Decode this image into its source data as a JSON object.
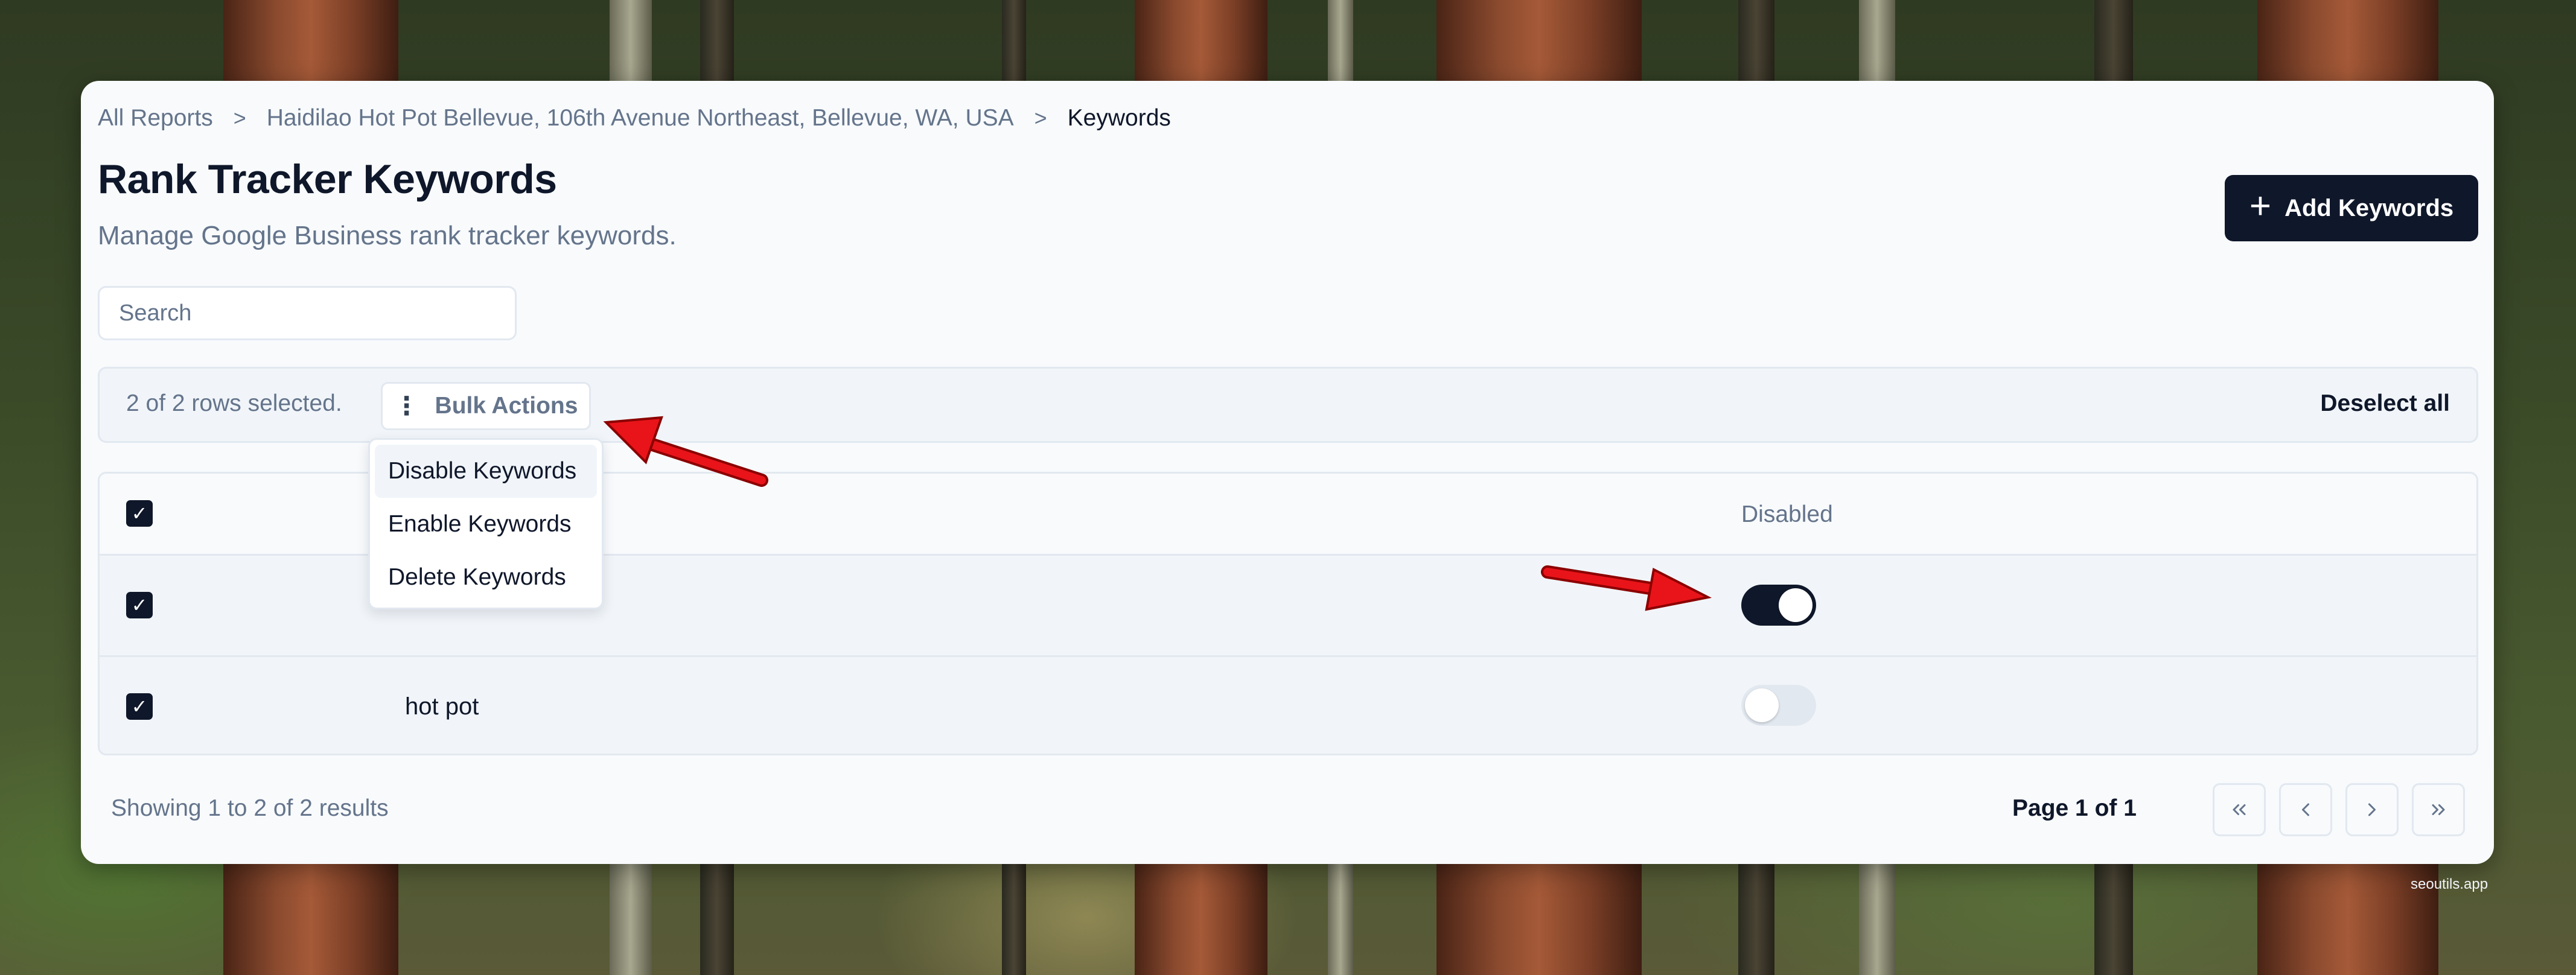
{
  "breadcrumb": {
    "items": [
      "All Reports",
      "Haidilao Hot Pot Bellevue, 106th Avenue Northeast, Bellevue, WA, USA",
      "Keywords"
    ],
    "separator": ">"
  },
  "header": {
    "title": "Rank Tracker Keywords",
    "subtitle": "Manage Google Business rank tracker keywords.",
    "add_button": "Add Keywords",
    "add_icon": "+"
  },
  "search": {
    "placeholder": "Search",
    "value": ""
  },
  "bulk_bar": {
    "selection_text": "2 of 2 rows selected.",
    "bulk_actions_label": "Bulk Actions",
    "bulk_actions_icon": "⋮",
    "deselect_label": "Deselect all"
  },
  "bulk_menu": {
    "open": true,
    "items": [
      "Disable Keywords",
      "Enable Keywords",
      "Delete Keywords"
    ],
    "highlighted_index": 0
  },
  "table": {
    "columns": [
      "",
      "",
      "Disabled"
    ],
    "rows": [
      {
        "selected": true,
        "keyword": "",
        "disabled": true
      },
      {
        "selected": true,
        "keyword": "hot pot",
        "disabled": false
      }
    ],
    "header_selected": true
  },
  "footer": {
    "results_text": "Showing 1 to 2 of 2 results",
    "page_text": "Page 1 of 1",
    "pagination_icons": [
      "first-page-icon",
      "previous-page-icon",
      "next-page-icon",
      "last-page-icon"
    ]
  },
  "colors": {
    "primary": "#0f172a",
    "muted_text": "#64748b",
    "border": "#e2e8f0",
    "annotation_arrow": "#e8141a"
  },
  "watermark": "seoutils.app"
}
